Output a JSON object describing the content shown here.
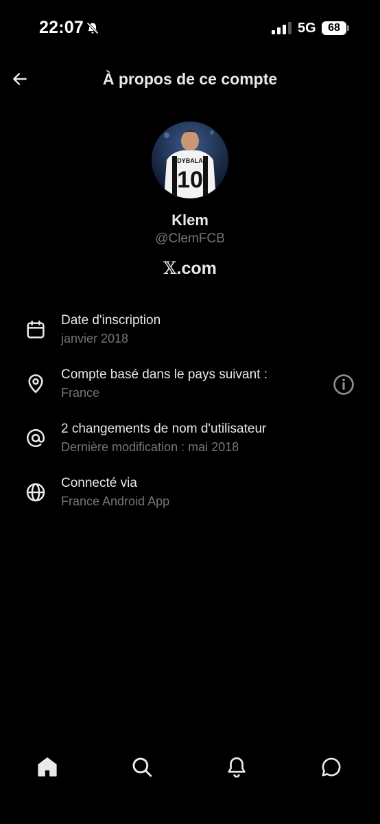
{
  "status_bar": {
    "time": "22:07",
    "network": "5G",
    "battery": "68",
    "icons": [
      "bell-off-icon",
      "signal-icon",
      "battery-icon"
    ]
  },
  "header": {
    "title": "À propos de ce compte",
    "back_icon": "arrow-left-icon"
  },
  "profile": {
    "display_name": "Klem",
    "handle": "@ClemFCB",
    "brand_mark": "𝕏",
    "brand_suffix": ".com",
    "avatar_jersey_name": "DYBALA",
    "avatar_jersey_number": "10"
  },
  "info": [
    {
      "icon": "calendar-icon",
      "primary": "Date d'inscription",
      "secondary": "janvier 2018"
    },
    {
      "icon": "location-pin-icon",
      "primary": "Compte basé dans le pays suivant :",
      "secondary": "France",
      "action_icon": "info-circle-icon"
    },
    {
      "icon": "at-sign-icon",
      "primary": "2 changements de nom d'utilisateur",
      "secondary": "Dernière modification : mai 2018"
    },
    {
      "icon": "globe-icon",
      "primary": "Connecté via",
      "secondary": "France Android App"
    }
  ],
  "bottom_nav": [
    {
      "icon": "home-icon",
      "active": true
    },
    {
      "icon": "search-icon",
      "active": false
    },
    {
      "icon": "bell-icon",
      "active": false
    },
    {
      "icon": "chat-bubble-icon",
      "active": false
    }
  ],
  "colors": {
    "background": "#000000",
    "text_primary": "#e7e9ea",
    "text_secondary": "#71767b"
  }
}
